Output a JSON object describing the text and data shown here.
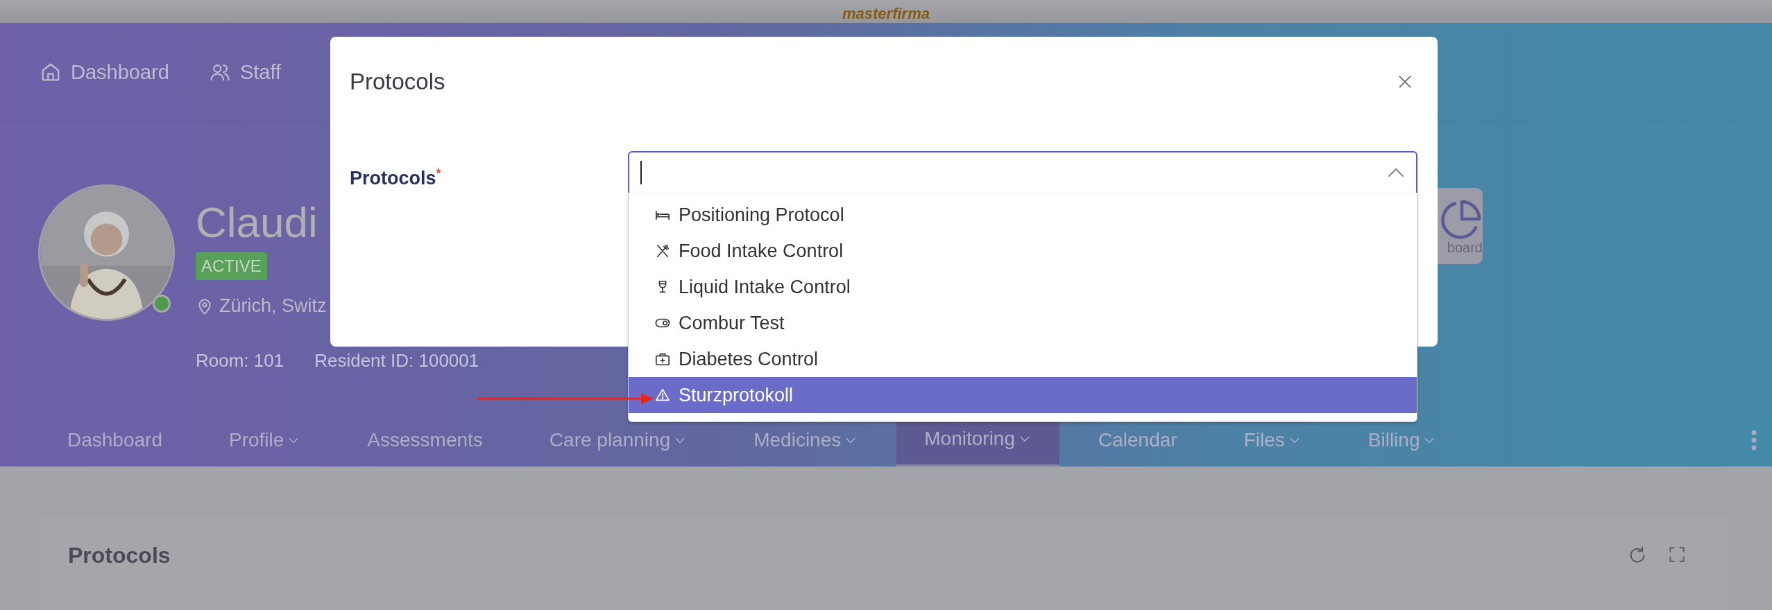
{
  "logo": "masterfirma",
  "top_nav": [
    {
      "label": "Dashboard",
      "kind": "home"
    },
    {
      "label": "Staff",
      "kind": "users"
    }
  ],
  "resident": {
    "name": "Claudi",
    "status": "ACTIVE",
    "online": true,
    "location": "Zürich, Switz",
    "room": "Room: 101",
    "resident_id": "Resident ID: 100001"
  },
  "dashboard_tile": {
    "label": "board"
  },
  "tabs": [
    {
      "label": "Dashboard",
      "selected": false,
      "has_menu": false
    },
    {
      "label": "Profile",
      "selected": false,
      "has_menu": true
    },
    {
      "label": "Assessments",
      "selected": false,
      "has_menu": false
    },
    {
      "label": "Care planning",
      "selected": false,
      "has_menu": true
    },
    {
      "label": "Medicines",
      "selected": false,
      "has_menu": true
    },
    {
      "label": "Monitoring",
      "selected": true,
      "has_menu": true
    },
    {
      "label": "Calendar",
      "selected": false,
      "has_menu": false
    },
    {
      "label": "Files",
      "selected": false,
      "has_menu": true
    },
    {
      "label": "Billing",
      "selected": false,
      "has_menu": true
    }
  ],
  "panel": {
    "title": "Protocols"
  },
  "modal": {
    "title": "Protocols",
    "field": {
      "label": "Protocols",
      "required_mark": "*",
      "expanded": true
    },
    "options": [
      {
        "label": "Positioning Protocol",
        "kind": "bed",
        "selected": false
      },
      {
        "label": "Food Intake Control",
        "kind": "cutlery",
        "selected": false
      },
      {
        "label": "Liquid Intake Control",
        "kind": "glass",
        "selected": false
      },
      {
        "label": "Combur Test",
        "kind": "toggle",
        "selected": false
      },
      {
        "label": "Diabetes Control",
        "kind": "medkit",
        "selected": false
      },
      {
        "label": "Sturzprotokoll",
        "kind": "warning",
        "selected": true
      }
    ]
  }
}
